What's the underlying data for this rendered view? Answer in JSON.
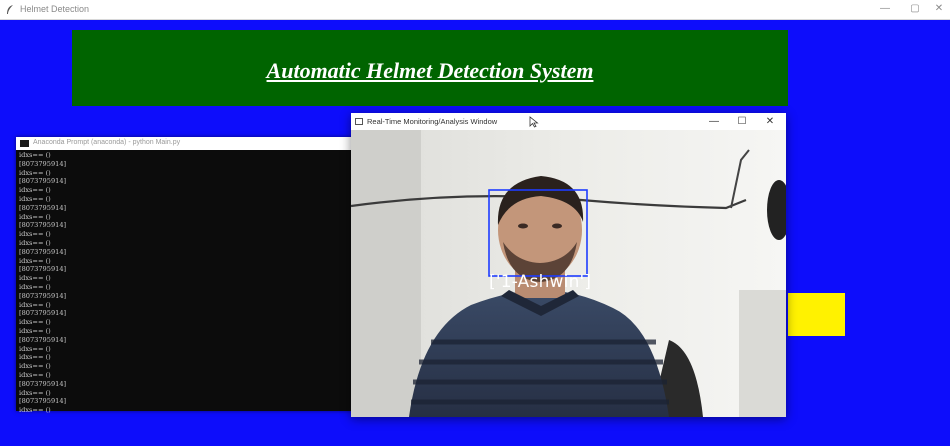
{
  "window": {
    "title": "Helmet Detection",
    "minimize": "—",
    "maximize": "▢",
    "close": "✕"
  },
  "banner": {
    "title": "Automatic Helmet Detection System"
  },
  "console": {
    "title": "Anaconda Prompt (anaconda) - python  Main.py",
    "lines": [
      "idxs== ()",
      "[8073795914]",
      "idxs== ()",
      "[8073795914]",
      "idxs== ()",
      "idxs== ()",
      "[8073795914]",
      "idxs== ()",
      "[8073795914]",
      "idxs== ()",
      "idxs== ()",
      "[8073795914]",
      "idxs== ()",
      "[8073795914]",
      "idxs== ()",
      "idxs== ()",
      "[8073795914]",
      "idxs== ()",
      "[8073795914]",
      "idxs== ()",
      "idxs== ()",
      "[8073795914]",
      "idxs== ()",
      "idxs== ()",
      "idxs== ()",
      "idxs== ()",
      "[8073795914]",
      "idxs== ()",
      "[8073795914]",
      "idxs== ()"
    ]
  },
  "monitor": {
    "title": "Real-Time Monitoring/Analysis Window",
    "minimize": "—",
    "maximize": "☐",
    "close": "✕",
    "detection_label": "['1-Ashwin']"
  },
  "colors": {
    "background": "#0d0dfb",
    "banner": "#006400",
    "yellow_box": "#fff200",
    "detection_box": "#1e3cff"
  },
  "icons": {
    "app": "feather-icon",
    "console": "terminal-icon",
    "monitor": "window-icon",
    "cursor": "mouse-cursor-icon"
  }
}
